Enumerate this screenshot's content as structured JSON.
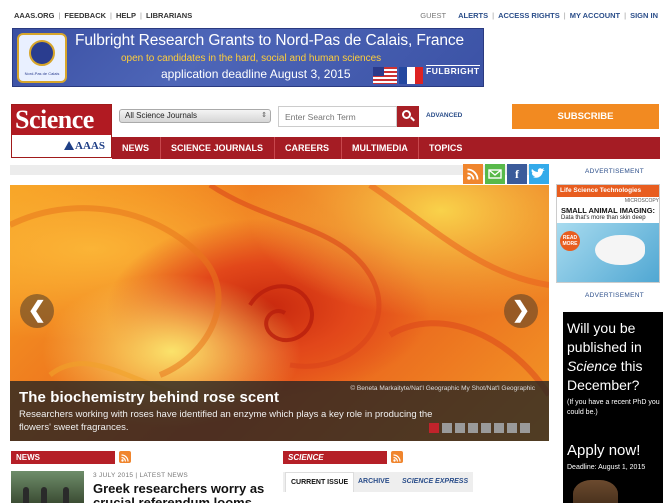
{
  "utility": {
    "left": [
      "AAAS.ORG",
      "FEEDBACK",
      "HELP",
      "LIBRARIANS"
    ],
    "guest": "GUEST",
    "right": [
      "ALERTS",
      "ACCESS RIGHTS",
      "MY ACCOUNT",
      "SIGN IN"
    ]
  },
  "banner": {
    "line1": "Fulbright Research Grants to Nord-Pas de Calais, France",
    "line2": "open to candidates in the hard, social and human sciences",
    "line3": "application deadline August 3, 2015",
    "brand": "FULBRIGHT",
    "seal_text": "Nord-Pas de Calais"
  },
  "logo": {
    "title": "Science",
    "org": "AAAS"
  },
  "search": {
    "journal_selected": "All Science Journals",
    "placeholder": "Enter Search Term",
    "advanced": "ADVANCED"
  },
  "subscribe": "SUBSCRIBE",
  "nav": [
    "NEWS",
    "SCIENCE JOURNALS",
    "CAREERS",
    "MULTIMEDIA",
    "TOPICS"
  ],
  "social": {
    "rss": "rss-icon",
    "email": "email-icon",
    "facebook": "f",
    "twitter": "twitter-icon"
  },
  "hero": {
    "headline": "The biochemistry behind rose scent",
    "dek": "Researchers working with roses have identified an enzyme which plays a key role in producing the flowers' sweet fragrances.",
    "credit": "© Beneta Markaityte/Nat'l Geographic My Shot/Nat'l Geographic",
    "prev": "❮",
    "next": "❯",
    "slides": 8,
    "active_slide": 1
  },
  "news": {
    "label": "NEWS",
    "date": "3 JULY 2015 | LATEST NEWS",
    "title": "Greek researchers worry as crucial referendum looms"
  },
  "science": {
    "label": "SCIENCE",
    "tabs": [
      "CURRENT ISSUE",
      "ARCHIVE",
      "SCIENCE EXPRESS"
    ]
  },
  "ads": {
    "label1": "ADVERTISEMENT",
    "label2": "ADVERTISEMENT",
    "ad1": {
      "brand": "Life Science Technologies",
      "small": "MICROSCOPY",
      "headline": "SMALL ANIMAL IMAGING:",
      "sub": "Data that's more than skin deep",
      "cta": "READ MORE"
    },
    "ad2": {
      "question_pre": "Will you be published in ",
      "question_em": "Science",
      "question_post": " this December?",
      "note": "(If you have a recent PhD you could be.)",
      "apply": "Apply now!",
      "deadline": "Deadline: August 1, 2015"
    }
  },
  "colors": {
    "brand_red": "#b11a22",
    "subscribe_orange": "#f28a21",
    "link_blue": "#2b4e8a"
  }
}
